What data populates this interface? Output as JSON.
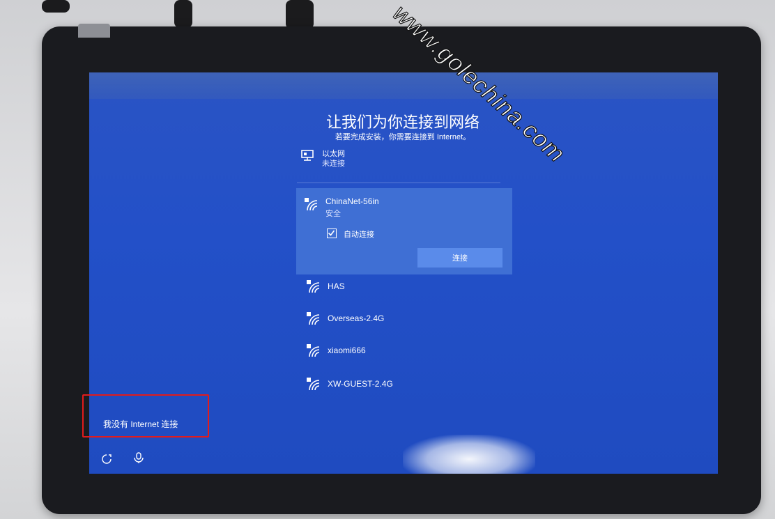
{
  "setup": {
    "title": "让我们为你连接到网络",
    "subtitle": "若要完成安装，你需要连接到 Internet。",
    "ethernet": {
      "name": "以太网",
      "status": "未连接"
    },
    "selected_network": {
      "name": "ChinaNet-56in",
      "security": "安全",
      "auto_connect_label": "自动连接",
      "auto_connect_checked": true,
      "connect_label": "连接"
    },
    "networks": [
      {
        "name": "HAS"
      },
      {
        "name": "Overseas-2.4G"
      },
      {
        "name": "xiaomi666"
      },
      {
        "name": "XW-GUEST-2.4G"
      }
    ],
    "no_internet_link": "我没有 Internet 连接"
  },
  "watermark": "www.golechina.com",
  "colors": {
    "screen_bg": "#2350c8",
    "selected_bg": "#3f6fd4",
    "button_bg": "#5a8bea",
    "highlight_box": "#e21b1b"
  },
  "icons": [
    "ethernet-icon",
    "wifi-secured-icon",
    "checkbox-checked-icon",
    "accessibility-icon",
    "microphone-icon"
  ]
}
